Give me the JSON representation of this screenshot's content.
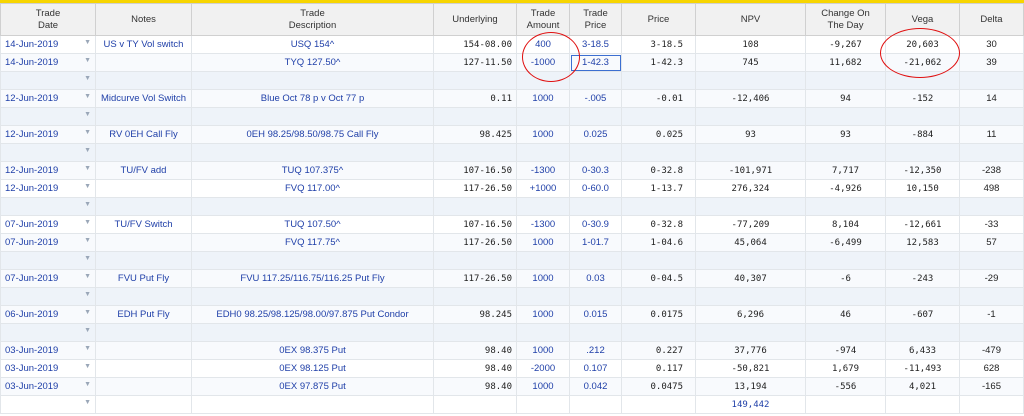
{
  "columns": [
    "Trade\nDate",
    "Notes",
    "Trade\nDescription",
    "Underlying",
    "Trade\nAmount",
    "Trade\nPrice",
    "Price",
    "NPV",
    "Change On\nThe Day",
    "Vega",
    "Delta"
  ],
  "rows": [
    {
      "type": "data",
      "date": "14-Jun-2019",
      "notes": "US v TY Vol switch",
      "desc": "USQ 154^",
      "und": "154-08.00",
      "amt": "400",
      "tp": "3-18.5",
      "price": "3-18.5",
      "npv": "108",
      "chg": "-9,267",
      "vega": "20,603",
      "delta": "30"
    },
    {
      "type": "data",
      "date": "14-Jun-2019",
      "notes": "",
      "desc": "TYQ 127.50^",
      "und": "127-11.50",
      "amt": "-1000",
      "tp": "1-42.3",
      "price": "1-42.3",
      "npv": "745",
      "chg": "11,682",
      "vega": "-21,062",
      "delta": "39",
      "boxed": true
    },
    {
      "type": "spacer"
    },
    {
      "type": "data",
      "date": "12-Jun-2019",
      "notes": "Midcurve Vol Switch",
      "desc": "Blue Oct 78 p v Oct 77 p",
      "und": "0.11",
      "amt": "1000",
      "tp": "-.005",
      "price": "-0.01",
      "npv": "-12,406",
      "chg": "94",
      "vega": "-152",
      "delta": "14"
    },
    {
      "type": "spacer"
    },
    {
      "type": "data",
      "date": "12-Jun-2019",
      "notes": "RV 0EH Call Fly",
      "desc": "0EH 98.25/98.50/98.75 Call Fly",
      "und": "98.425",
      "amt": "1000",
      "tp": "0.025",
      "price": "0.025",
      "npv": "93",
      "chg": "93",
      "vega": "-884",
      "delta": "11"
    },
    {
      "type": "spacer"
    },
    {
      "type": "data",
      "date": "12-Jun-2019",
      "notes": "TU/FV add",
      "desc": "TUQ 107.375^",
      "und": "107-16.50",
      "amt": "-1300",
      "tp": "0-30.3",
      "price": "0-32.8",
      "npv": "-101,971",
      "chg": "7,717",
      "vega": "-12,350",
      "delta": "-238"
    },
    {
      "type": "data",
      "date": "12-Jun-2019",
      "notes": "",
      "desc": "FVQ 117.00^",
      "und": "117-26.50",
      "amt": "+1000",
      "tp": "0-60.0",
      "price": "1-13.7",
      "npv": "276,324",
      "chg": "-4,926",
      "vega": "10,150",
      "delta": "498"
    },
    {
      "type": "spacer"
    },
    {
      "type": "data",
      "date": "07-Jun-2019",
      "notes": "TU/FV Switch",
      "desc": "TUQ 107.50^",
      "und": "107-16.50",
      "amt": "-1300",
      "tp": "0-30.9",
      "price": "0-32.8",
      "npv": "-77,209",
      "chg": "8,104",
      "vega": "-12,661",
      "delta": "-33"
    },
    {
      "type": "data",
      "date": "07-Jun-2019",
      "notes": "",
      "desc": "FVQ 117.75^",
      "und": "117-26.50",
      "amt": "1000",
      "tp": "1-01.7",
      "price": "1-04.6",
      "npv": "45,064",
      "chg": "-6,499",
      "vega": "12,583",
      "delta": "57"
    },
    {
      "type": "spacer"
    },
    {
      "type": "data",
      "date": "07-Jun-2019",
      "notes": "FVU Put Fly",
      "desc": "FVU 117.25/116.75/116.25 Put Fly",
      "und": "117-26.50",
      "amt": "1000",
      "tp": "0.03",
      "price": "0-04.5",
      "npv": "40,307",
      "chg": "-6",
      "vega": "-243",
      "delta": "-29"
    },
    {
      "type": "spacer"
    },
    {
      "type": "data",
      "date": "06-Jun-2019",
      "notes": "EDH Put Fly",
      "desc": "EDH0 98.25/98.125/98.00/97.875 Put Condor",
      "und": "98.245",
      "amt": "1000",
      "tp": "0.015",
      "price": "0.0175",
      "npv": "6,296",
      "chg": "46",
      "vega": "-607",
      "delta": "-1"
    },
    {
      "type": "spacer"
    },
    {
      "type": "data",
      "date": "03-Jun-2019",
      "notes": "",
      "desc": "0EX 98.375 Put",
      "und": "98.40",
      "amt": "1000",
      "tp": ".212",
      "price": "0.227",
      "npv": "37,776",
      "chg": "-974",
      "vega": "6,433",
      "delta": "-479"
    },
    {
      "type": "data",
      "date": "03-Jun-2019",
      "notes": "",
      "desc": "0EX 98.125 Put",
      "und": "98.40",
      "amt": "-2000",
      "tp": "0.107",
      "price": "0.117",
      "npv": "-50,821",
      "chg": "1,679",
      "vega": "-11,493",
      "delta": "628"
    },
    {
      "type": "data",
      "date": "03-Jun-2019",
      "notes": "",
      "desc": "0EX 97.875 Put",
      "und": "98.40",
      "amt": "1000",
      "tp": "0.042",
      "price": "0.0475",
      "npv": "13,194",
      "chg": "-556",
      "vega": "4,021",
      "delta": "-165"
    }
  ],
  "total_npv": "149,442",
  "dropdown_glyph": "▼",
  "colors": {
    "accent_bar": "#f7d500",
    "link_blue": "#1f3fa8",
    "annotation_red": "#e01010"
  }
}
